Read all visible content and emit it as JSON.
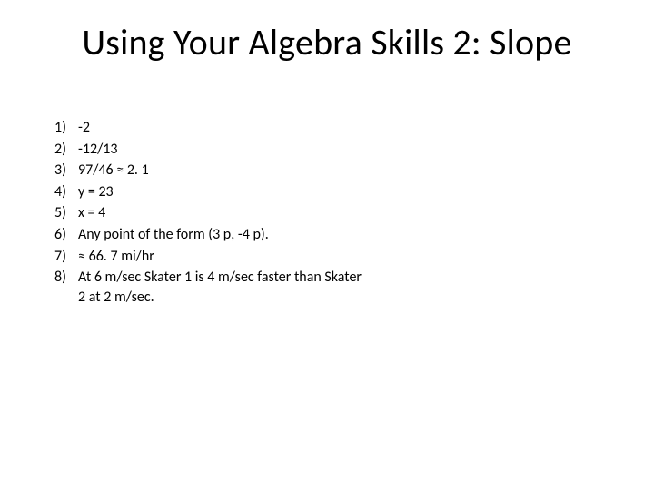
{
  "title": "Using Your Algebra Skills 2: Slope",
  "items": [
    {
      "n": "1)",
      "a": "-2"
    },
    {
      "n": "2)",
      "a": "-12/13"
    },
    {
      "n": "3)",
      "a": "97/46 ≈ 2. 1"
    },
    {
      "n": "4)",
      "a": "y = 23"
    },
    {
      "n": "5)",
      "a": "x = 4"
    },
    {
      "n": "6)",
      "a": "Any point of the form (3 p, -4 p)."
    },
    {
      "n": "7)",
      "a": "≈ 66. 7 mi/hr"
    },
    {
      "n": "8)",
      "a": "At 6 m/sec Skater 1 is 4 m/sec faster than Skater 2 at 2 m/sec."
    }
  ]
}
